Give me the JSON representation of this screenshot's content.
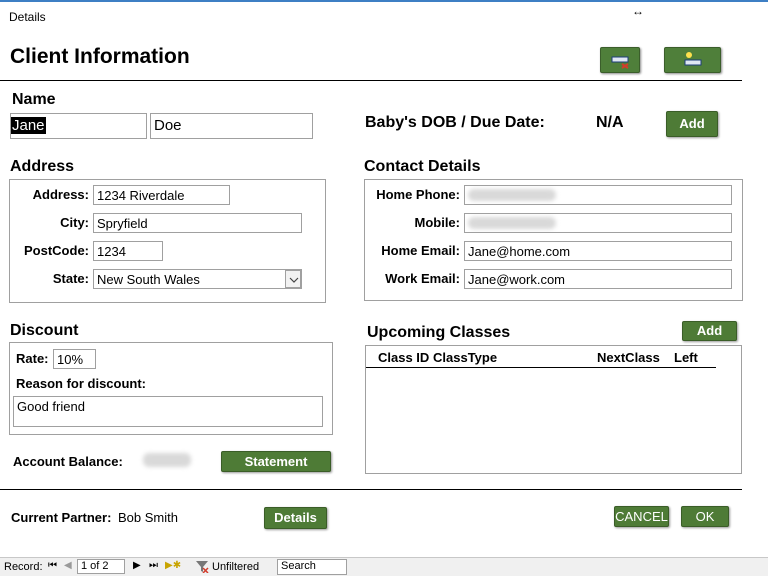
{
  "window": {
    "tab_title": "Details",
    "resize_glyph": "↔"
  },
  "header": {
    "title": "Client Information",
    "icon_buttons": [
      "record-edit-icon",
      "new-record-icon"
    ]
  },
  "name": {
    "section": "Name",
    "first": "Jane",
    "last": "Doe"
  },
  "baby": {
    "label": "Baby's DOB / Due Date:",
    "value": "N/A",
    "add_label": "Add"
  },
  "address": {
    "section": "Address",
    "labels": {
      "address": "Address:",
      "city": "City:",
      "postcode": "PostCode:",
      "state": "State:"
    },
    "values": {
      "address": "1234 Riverdale",
      "city": "Spryfield",
      "postcode": "1234",
      "state": "New South Wales"
    }
  },
  "contact": {
    "section": "Contact Details",
    "labels": {
      "home_phone": "Home Phone:",
      "mobile": "Mobile:",
      "home_email": "Home Email:",
      "work_email": "Work Email:"
    },
    "values": {
      "home_email": "Jane@home.com",
      "work_email": "Jane@work.com"
    }
  },
  "discount": {
    "section": "Discount",
    "rate_label": "Rate:",
    "rate": "10%",
    "reason_label": "Reason for discount:",
    "reason": "Good friend"
  },
  "classes": {
    "section": "Upcoming Classes",
    "add_label": "Add",
    "columns": [
      "Class ID",
      "ClassType",
      "NextClass",
      "Left"
    ]
  },
  "account": {
    "label": "Account Balance:",
    "statement_label": "Statement"
  },
  "partner": {
    "label": "Current Partner:",
    "name": "Bob Smith",
    "details_label": "Details"
  },
  "actions": {
    "cancel": "CANCEL",
    "ok": "OK"
  },
  "statusbar": {
    "record_label": "Record:",
    "position": "1 of 2",
    "filter": "Unfiltered",
    "search": "Search"
  },
  "colors": {
    "button_green": "#4e7b36",
    "window_accent": "#3e7fc4",
    "selection": "#000000"
  }
}
